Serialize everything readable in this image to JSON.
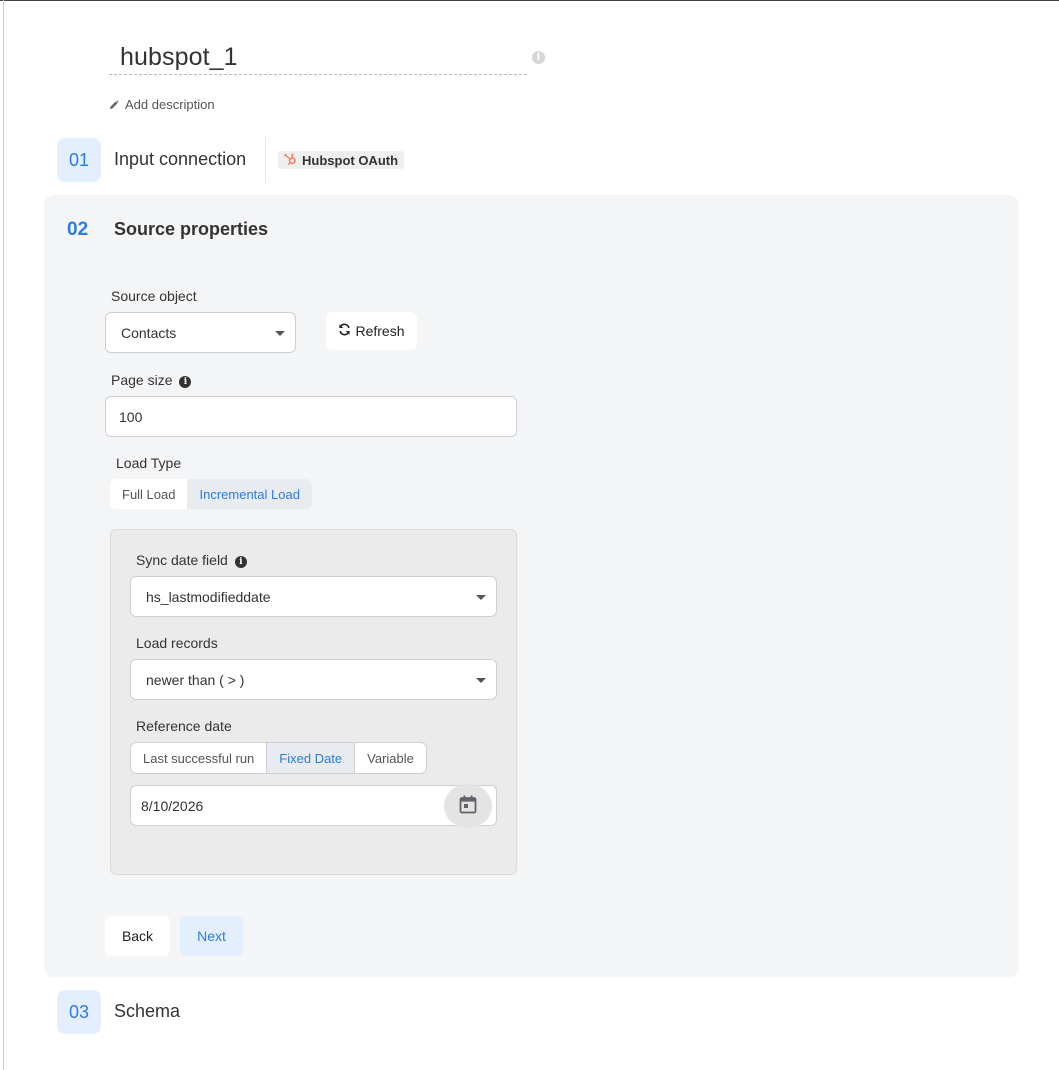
{
  "header": {
    "title": "hubspot_1",
    "add_description": "Add description"
  },
  "steps": [
    {
      "number": "01",
      "label": "Input connection",
      "connection_badge": "Hubspot OAuth"
    },
    {
      "number": "02",
      "label": "Source properties"
    },
    {
      "number": "03",
      "label": "Schema"
    }
  ],
  "source_properties": {
    "source_object": {
      "label": "Source object",
      "value": "Contacts"
    },
    "refresh_label": "Refresh",
    "page_size": {
      "label": "Page size",
      "value": "100"
    },
    "load_type": {
      "label": "Load Type",
      "options": [
        "Full Load",
        "Incremental Load"
      ],
      "selected": "Incremental Load"
    },
    "incremental": {
      "sync_date_field": {
        "label": "Sync date field",
        "value": "hs_lastmodifieddate"
      },
      "load_records": {
        "label": "Load records",
        "value": "newer than ( > )"
      },
      "reference_date": {
        "label": "Reference date",
        "options": [
          "Last successful run",
          "Fixed Date",
          "Variable"
        ],
        "selected": "Fixed Date",
        "date_value": "8/10/2026"
      }
    },
    "back_label": "Back",
    "next_label": "Next"
  },
  "colors": {
    "accent": "#2d7be5",
    "accent_bg": "#e3efff",
    "panel_bg": "#f4f5f7",
    "hubspot_orange": "#ff7a59"
  },
  "icons": {
    "title_info": "info-icon",
    "add_description": "pencil-icon",
    "connection": "hubspot-logo-icon",
    "refresh": "refresh-icon",
    "page_size_info": "info-icon",
    "sync_date_info": "info-icon",
    "calendar": "calendar-icon"
  }
}
